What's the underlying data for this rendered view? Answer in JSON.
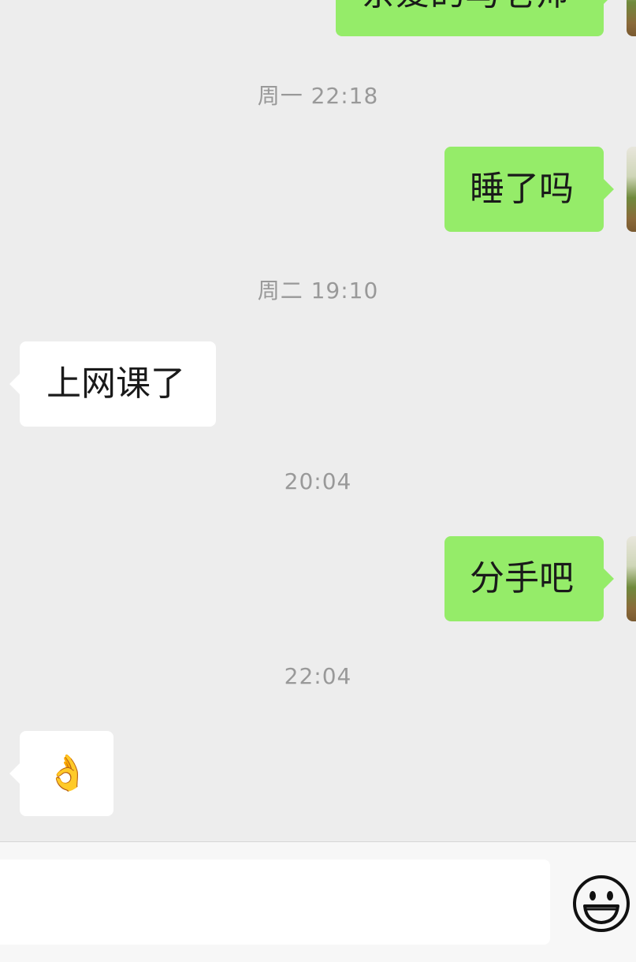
{
  "messages": [
    {
      "side": "mine",
      "text": "亲爱的马老师"
    },
    {
      "time": "周一 22:18"
    },
    {
      "side": "mine",
      "text": "睡了吗"
    },
    {
      "time": "周二 19:10"
    },
    {
      "side": "theirs",
      "text": "上网课了"
    },
    {
      "time": "20:04"
    },
    {
      "side": "mine",
      "text": "分手吧"
    },
    {
      "time": "22:04"
    },
    {
      "side": "theirs",
      "text": "👌"
    }
  ],
  "input": {
    "value": "",
    "placeholder": ""
  },
  "icons": {
    "emoji_button": "smiley-face-icon",
    "avatar": "user-avatar"
  },
  "colors": {
    "mine_bubble": "#95ec69",
    "theirs_bubble": "#ffffff",
    "background": "#ededed",
    "timestamp": "#999999"
  }
}
